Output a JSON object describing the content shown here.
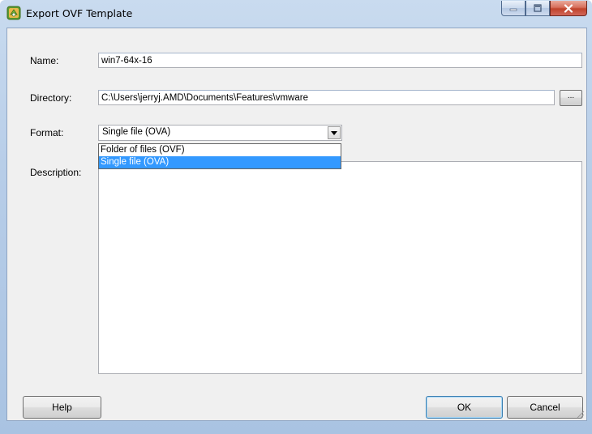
{
  "window": {
    "title": "Export OVF Template",
    "icon": "vsphere-client-icon",
    "controls": {
      "minimize": "minimize-icon",
      "maximize": "maximize-icon",
      "close": "close-icon"
    }
  },
  "form": {
    "name": {
      "label": "Name:",
      "value": "win7-64x-16"
    },
    "directory": {
      "label": "Directory:",
      "value": "C:\\Users\\jerryj.AMD\\Documents\\Features\\vmware",
      "browse_label": "..."
    },
    "format": {
      "label": "Format:",
      "value": "Single file (OVA)",
      "options": [
        "Folder of files (OVF)",
        "Single file (OVA)"
      ],
      "highlighted_index": 1
    },
    "description": {
      "label": "Description:",
      "value": ""
    }
  },
  "buttons": {
    "help": "Help",
    "ok": "OK",
    "cancel": "Cancel"
  },
  "colors": {
    "selection": "#3399ff",
    "client_bg": "#f0f0f0",
    "frame": "#b7cde8"
  }
}
